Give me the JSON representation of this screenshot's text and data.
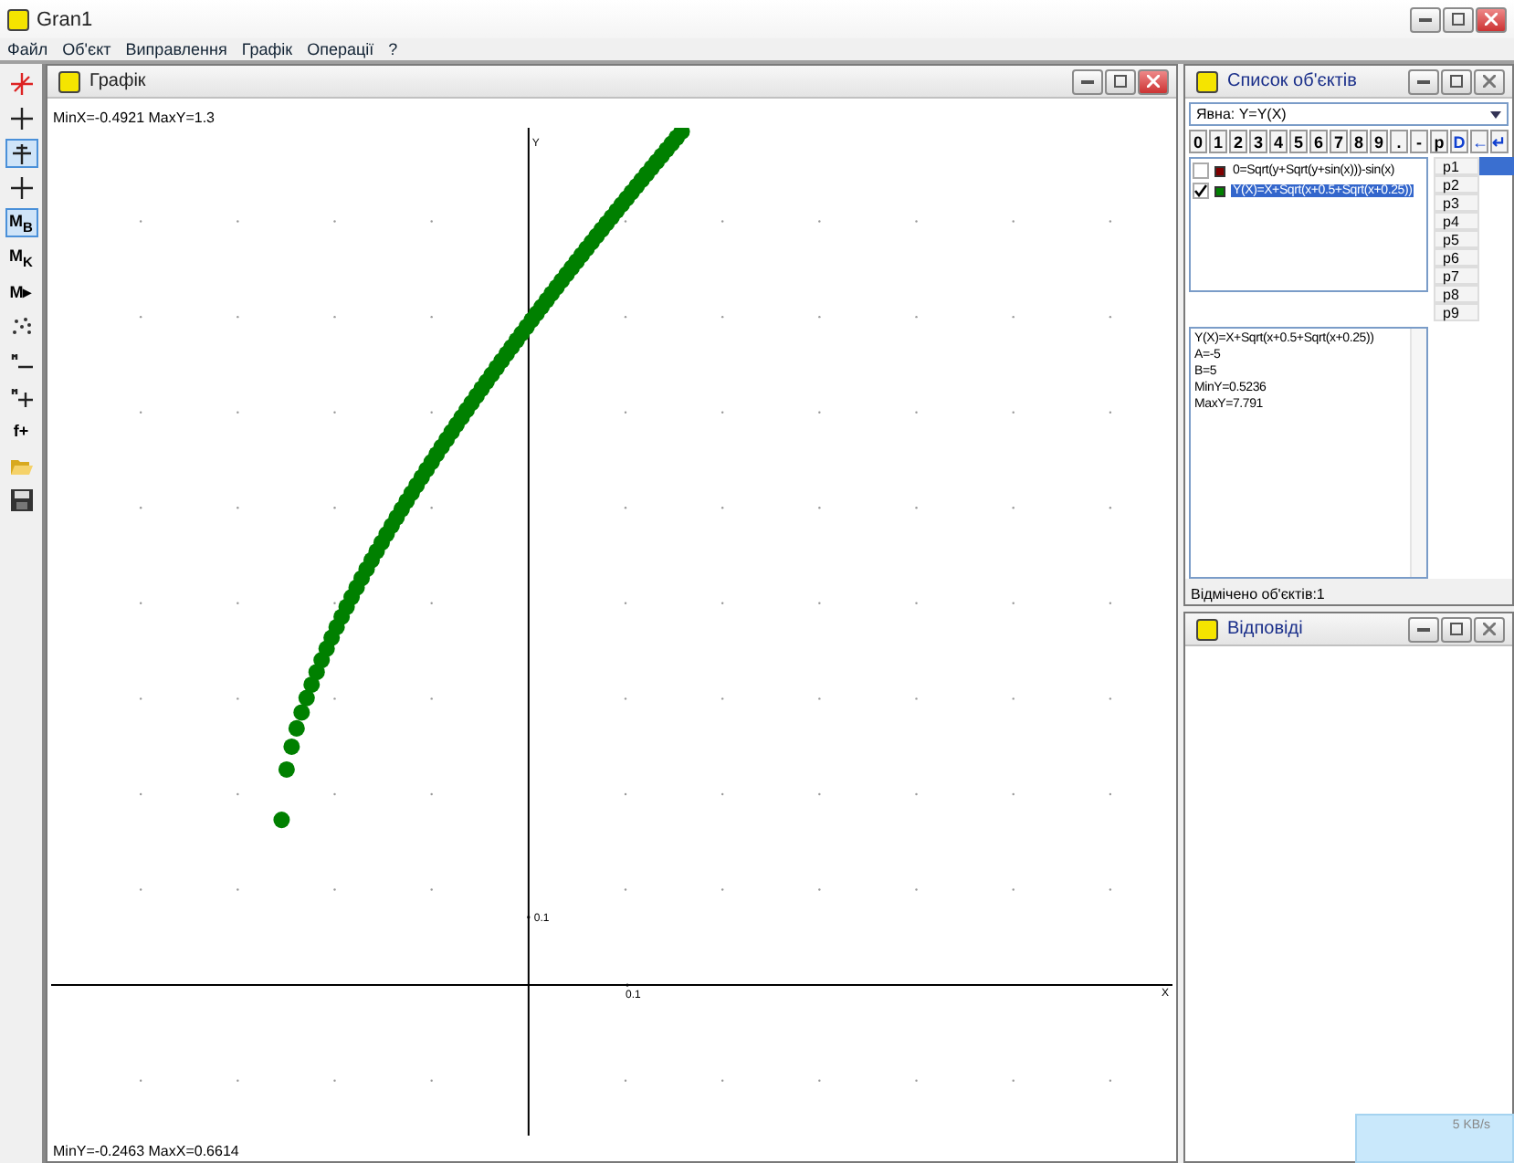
{
  "window": {
    "title": "Gran1"
  },
  "menu": [
    "Файл",
    "Об'єкт",
    "Виправлення",
    "Графік",
    "Операції",
    "?"
  ],
  "toolbar": [
    {
      "kind": "axes",
      "selected": false
    },
    {
      "kind": "cross",
      "selected": false
    },
    {
      "kind": "pointer",
      "selected": true
    },
    {
      "kind": "cross",
      "selected": false
    },
    {
      "kind": "letters",
      "label": "M",
      "sub": "B",
      "selected": true
    },
    {
      "kind": "letters",
      "label": "M",
      "sub": "K",
      "selected": false
    },
    {
      "kind": "letters",
      "label": "M▸",
      "selected": false
    },
    {
      "kind": "scatter",
      "selected": false
    },
    {
      "kind": "minus",
      "selected": false
    },
    {
      "kind": "plus",
      "selected": false
    },
    {
      "kind": "letters",
      "label": "f+",
      "selected": false
    },
    {
      "kind": "open",
      "selected": false
    },
    {
      "kind": "save",
      "selected": false
    }
  ],
  "graph": {
    "title": "Графік",
    "top_status": "MinX=-0.4921  MaxY=1.3",
    "bottom_status": "MinY=-0.2463  MaxX=0.6614",
    "x_label": "X",
    "y_label": "Y",
    "x_tick": "0.1",
    "y_tick": "0.1"
  },
  "objects_panel": {
    "title": "Список об'єктів",
    "mode": "Явна: Y=Y(X)",
    "keys": [
      "0",
      "1",
      "2",
      "3",
      "4",
      "5",
      "6",
      "7",
      "8",
      "9",
      ".",
      "-",
      "p",
      "D",
      "←",
      "↵"
    ],
    "objects": [
      {
        "text": "0=Sqrt(y+Sqrt(y+sin(x)))-sin(x)",
        "checked": false,
        "color": "#800000",
        "selected": false
      },
      {
        "text": "Y(X)=X+Sqrt(x+0.5+Sqrt(x+0.25))",
        "checked": true,
        "color": "#008000",
        "selected": true
      }
    ],
    "params": [
      {
        "label": "p1",
        "selected": true
      },
      {
        "label": "p2",
        "selected": false
      },
      {
        "label": "p3",
        "selected": false
      },
      {
        "label": "p4",
        "selected": false
      },
      {
        "label": "p5",
        "selected": false
      },
      {
        "label": "p6",
        "selected": false
      },
      {
        "label": "p7",
        "selected": false
      },
      {
        "label": "p8",
        "selected": false
      },
      {
        "label": "p9",
        "selected": false
      }
    ],
    "info": [
      "Y(X)=X+Sqrt(x+0.5+Sqrt(x+0.25))",
      "A=-5",
      "B=5",
      "MinY=0.5236",
      "MaxY=7.791"
    ],
    "status": "Відмічено об'єктів:1"
  },
  "answers_panel": {
    "title": "Відповіді"
  },
  "network_meter": {
    "speed": "5 KB/s"
  }
}
